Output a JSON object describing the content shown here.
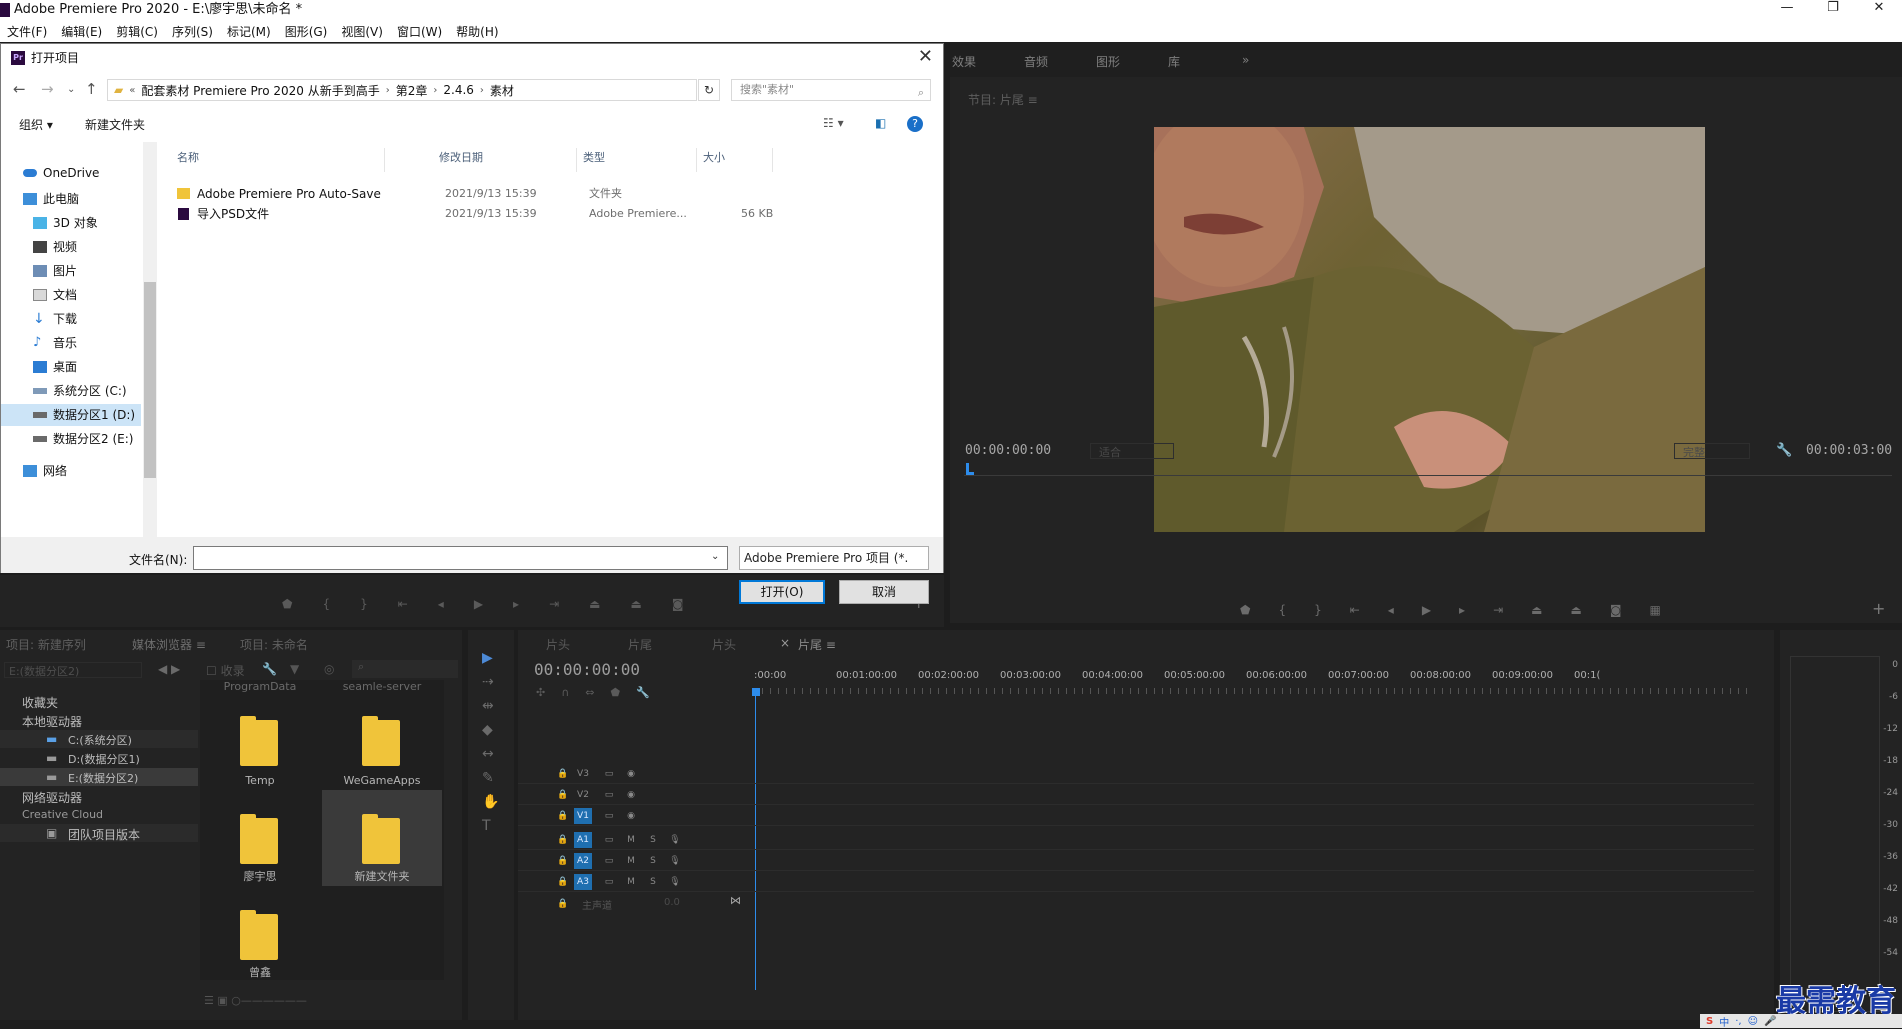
{
  "app": {
    "window_title": "Adobe Premiere Pro 2020 - E:\\廖宇思\\未命名 *",
    "window_controls": [
      "—",
      "❐",
      "✕"
    ],
    "menu": [
      "文件(F)",
      "编辑(E)",
      "剪辑(C)",
      "序列(S)",
      "标记(M)",
      "图形(G)",
      "视图(V)",
      "窗口(W)",
      "帮助(H)"
    ]
  },
  "dialog": {
    "title": "打开项目",
    "close": "✕",
    "address": [
      "«",
      "配套素材 Premiere Pro 2020 从新手到高手",
      "第2章",
      "2.4.6",
      "素材"
    ],
    "search_placeholder": "搜索\"素材\"",
    "toolbar": {
      "organize": "组织 ▾",
      "new_folder": "新建文件夹"
    },
    "nav_items": [
      "OneDrive",
      "此电脑",
      "3D 对象",
      "视频",
      "图片",
      "文档",
      "下载",
      "音乐",
      "桌面",
      "系统分区 (C:)",
      "数据分区1 (D:)",
      "数据分区2 (E:)",
      "网络"
    ],
    "columns": [
      "名称",
      "修改日期",
      "类型",
      "大小"
    ],
    "files": [
      {
        "name": "Adobe Premiere Pro Auto-Save",
        "date": "2021/9/13 15:39",
        "type": "文件夹",
        "size": ""
      },
      {
        "name": "导入PSD文件",
        "date": "2021/9/13 15:39",
        "type": "Adobe Premiere...",
        "size": "56 KB"
      }
    ],
    "filename_label": "文件名(N):",
    "filename_value": "",
    "filetype": "Adobe Premiere Pro 项目 (*.",
    "open_btn": "打开(O)",
    "cancel_btn": "取消"
  },
  "program": {
    "tabs": [
      "效果",
      "音频",
      "图形",
      "库",
      "»"
    ],
    "header": "节目: 片尾  ≡",
    "timecode_left": "00:00:00:00",
    "fit": "适合",
    "quality": "完整",
    "timecode_right": "00:00:03:00"
  },
  "project": {
    "tabs": [
      "项目: 新建序列",
      "媒体浏览器  ≡",
      "项目: 未命名"
    ],
    "path_select": "E:(数据分区2)",
    "ingest": "收录",
    "tree": [
      "收藏夹",
      "本地驱动器",
      "C:(系统分区)",
      "D:(数据分区1)",
      "E:(数据分区2)",
      "网络驱动器",
      "Creative Cloud",
      "团队项目版本"
    ],
    "tiles_top": [
      "ProgramData",
      "seamle-server"
    ],
    "tiles": [
      "Temp",
      "WeGameApps",
      "廖宇思",
      "新建文件夹",
      "曾鑫"
    ]
  },
  "timeline": {
    "tabs": [
      "片头",
      "片尾",
      "片头",
      "片尾  ≡"
    ],
    "close_x": "×",
    "timecode": "00:00:00:00",
    "ruler": [
      ":00:00",
      "00:01:00:00",
      "00:02:00:00",
      "00:03:00:00",
      "00:04:00:00",
      "00:05:00:00",
      "00:06:00:00",
      "00:07:00:00",
      "00:08:00:00",
      "00:09:00:00",
      "00:1("
    ],
    "video_tracks": [
      "V3",
      "V2",
      "V1"
    ],
    "audio_tracks": [
      "A1",
      "A2",
      "A3"
    ],
    "track_m": "M",
    "track_s": "S",
    "master": "主声道",
    "master_val": "0.0"
  },
  "meter": {
    "labels": [
      "0",
      "-6",
      "-12",
      "-18",
      "-24",
      "-30",
      "-36",
      "-42",
      "-48",
      "-54"
    ]
  },
  "watermark": "最需教育",
  "ime": [
    "中",
    "·,",
    "☺",
    "🎤"
  ]
}
